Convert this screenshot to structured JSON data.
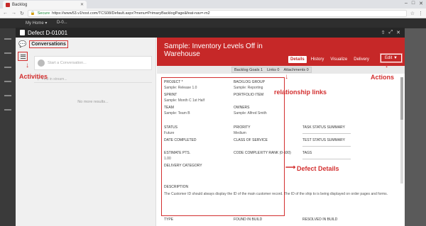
{
  "browser": {
    "tab_title": "Backlog",
    "secure_label": "Secure",
    "url": "https://www53.v1host.com/TCS08/Default.aspx?menu=PrimaryBacklogPage&feat-nav=-m2"
  },
  "app": {
    "header_dropdown": "My Home ▾",
    "header_id": "D-0..."
  },
  "modal": {
    "title": "Defect D-01001",
    "conversations": {
      "title": "Conversations",
      "start_placeholder": "Start a Conversation...",
      "find_placeholder": "Find in stream...",
      "no_more": "No more results..."
    },
    "header": {
      "title": "Sample: Inventory Levels Off in Warehouse",
      "tabs": [
        "Details",
        "History",
        "Visualize",
        "Delivery"
      ],
      "edit_label": "Edit"
    },
    "relationships": {
      "backlog_goals": "Backlog Goals  1",
      "links": "Links  0",
      "attachments": "Attachments  0"
    },
    "fields": {
      "project": {
        "label": "Project *",
        "value": "Sample: Release 1.0"
      },
      "sprint": {
        "label": "Sprint",
        "value": "Sample: Month C 1st Half"
      },
      "team": {
        "label": "Team",
        "value": "Sample: Team B"
      },
      "status": {
        "label": "Status",
        "value": "Future"
      },
      "date_completed": {
        "label": "Date Completed",
        "value": ""
      },
      "estimate": {
        "label": "Estimate Pts.",
        "value": "1.00"
      },
      "delivery_category": {
        "label": "Delivery Category",
        "value": ""
      },
      "backlog_group": {
        "label": "Backlog Group",
        "value": "Sample: Reporting"
      },
      "portfolio_item": {
        "label": "Portfolio Item",
        "value": ""
      },
      "owners": {
        "label": "Owners",
        "value": "Sample: Alfred Smith"
      },
      "priority": {
        "label": "Priority",
        "value": "Medium"
      },
      "class_of_service": {
        "label": "Class of Service",
        "value": ""
      },
      "code_complexity": {
        "label": "Code Complexity Rank (0-100)",
        "value": ""
      },
      "task_status": {
        "label": "Task Status Summary"
      },
      "test_status": {
        "label": "Test Status Summary"
      },
      "tags": {
        "label": "Tags"
      },
      "description": {
        "label": "Description",
        "value": "The Customer ID should always display the ID of the main customer record. The ID of the ship to is being displayed on order pages and forms."
      },
      "type": {
        "label": "Type"
      },
      "found_in_build": {
        "label": "Found in Build"
      },
      "resolved_in_build": {
        "label": "Resolved in Build"
      }
    }
  },
  "annotations": {
    "activities": "Activities",
    "relationship_links": "relationship links",
    "actions": "Actions",
    "defect_details": "Defect Details"
  },
  "colors": {
    "header_red": "#c62828",
    "annotation_red": "#d32f2f",
    "modal_header": "#262626"
  }
}
